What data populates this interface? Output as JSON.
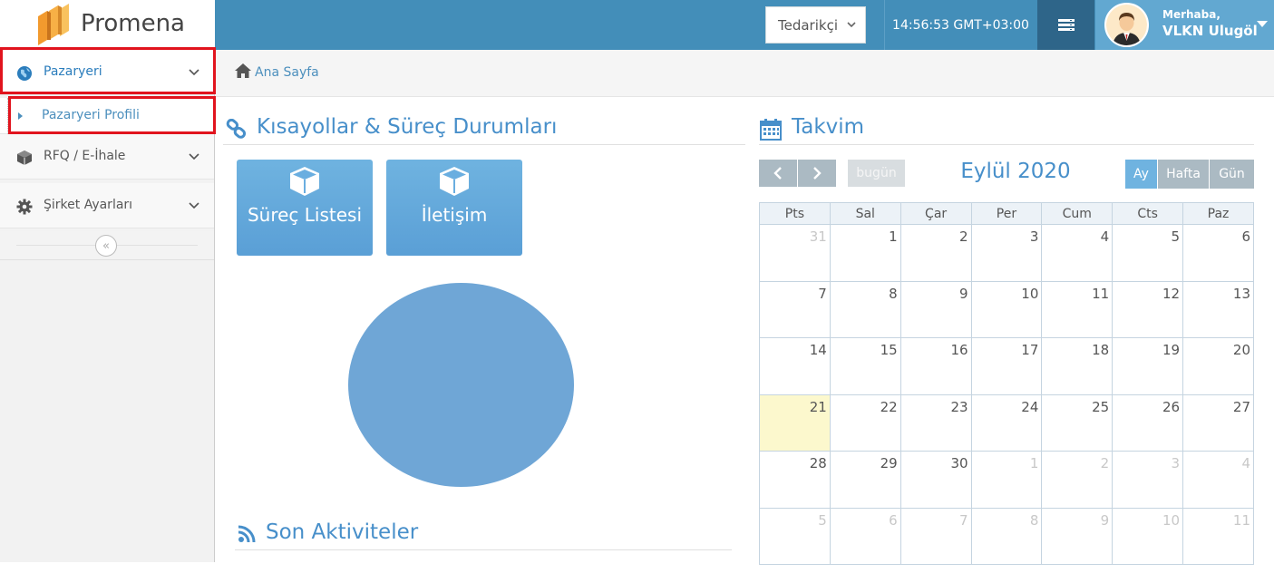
{
  "header": {
    "logo_text": "Promena",
    "role_select_value": "Tedarikçi",
    "clock": "14:56:53 GMT+03:00",
    "greeting": "Merhaba,",
    "username": "VLKN Ulugöl",
    "colors": {
      "bar": "#438eb9",
      "menu_button": "#2e6589",
      "user_area": "#62a8d1"
    }
  },
  "sidebar": {
    "items": [
      {
        "label": "Pazaryeri",
        "icon": "globe-icon",
        "expanded": true
      },
      {
        "label": "RFQ / E-İhale",
        "icon": "box-icon"
      },
      {
        "label": "Şirket Ayarları",
        "icon": "gear-icon"
      }
    ],
    "sub_items": [
      {
        "label": "Pazaryeri Profili",
        "active": true
      }
    ],
    "collapse_icon": "double-chevron-left-icon"
  },
  "breadcrumb": {
    "home_label": "Ana Sayfa",
    "icon": "home-icon"
  },
  "shortcuts": {
    "title": "Kısayollar & Süreç Durumları",
    "icon": "link-icon",
    "tiles": [
      {
        "label": "Süreç Listesi",
        "icon": "cube-icon"
      },
      {
        "label": "İletişim",
        "icon": "cube-icon"
      }
    ]
  },
  "activities": {
    "title": "Son Aktiviteler",
    "icon": "rss-icon"
  },
  "calendar": {
    "title": "Takvim",
    "icon": "calendar-icon",
    "month_title": "Eylül 2020",
    "today_label": "bugün",
    "views": [
      "Ay",
      "Hafta",
      "Gün"
    ],
    "active_view": "Ay",
    "weekdays": [
      "Pts",
      "Sal",
      "Çar",
      "Per",
      "Cum",
      "Cts",
      "Paz"
    ],
    "weeks": [
      [
        "31",
        "1",
        "2",
        "3",
        "4",
        "5",
        "6"
      ],
      [
        "7",
        "8",
        "9",
        "10",
        "11",
        "12",
        "13"
      ],
      [
        "14",
        "15",
        "16",
        "17",
        "18",
        "19",
        "20"
      ],
      [
        "21",
        "22",
        "23",
        "24",
        "25",
        "26",
        "27"
      ],
      [
        "28",
        "29",
        "30",
        "1",
        "2",
        "3",
        "4"
      ],
      [
        "5",
        "6",
        "7",
        "8",
        "9",
        "10",
        "11"
      ]
    ],
    "today": "21",
    "colors": {
      "today_bg": "#fcf8cd",
      "accent": "#478fca"
    }
  },
  "chart_data": {
    "type": "pie",
    "values": [
      100
    ],
    "colors": [
      "#6fa6d6"
    ]
  }
}
